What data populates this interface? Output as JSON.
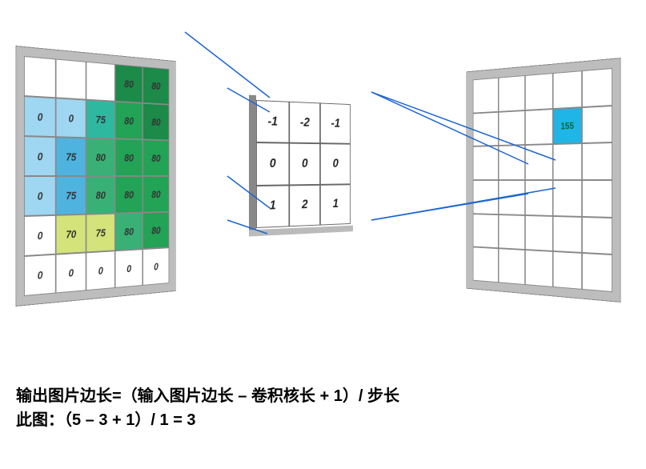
{
  "input_grid": [
    [
      "",
      "",
      "",
      "80",
      "80"
    ],
    [
      "0",
      "0",
      "75",
      "80",
      "80"
    ],
    [
      "0",
      "75",
      "80",
      "80",
      "80"
    ],
    [
      "0",
      "75",
      "80",
      "80",
      "80"
    ],
    [
      "0",
      "70",
      "75",
      "80",
      "80"
    ],
    [
      "0",
      "0",
      "0",
      "0",
      "0"
    ]
  ],
  "input_colors": [
    [
      "",
      "",
      "",
      "dg",
      "dg"
    ],
    [
      "lb",
      "lb",
      "cy",
      "gr",
      "dg"
    ],
    [
      "lb",
      "bl",
      "tg",
      "gr",
      "gr"
    ],
    [
      "lb",
      "bl",
      "tg",
      "gr",
      "gr"
    ],
    [
      "",
      "yg",
      "yg",
      "tg",
      "gr"
    ],
    [
      "",
      "",
      "",
      "",
      ""
    ]
  ],
  "kernel": [
    [
      "-1",
      "-2",
      "-1"
    ],
    [
      "0",
      "0",
      "0"
    ],
    [
      "1",
      "2",
      "1"
    ]
  ],
  "output_active": {
    "row": 1,
    "col": 3,
    "value": "155"
  },
  "output_rows": 6,
  "output_cols": 5,
  "caption_line1": "输出图片边长=（输入图片边长 – 卷积核长 + 1）/ 步长",
  "caption_line2": "此图：（5 – 3 + 1）/ 1  =  3"
}
